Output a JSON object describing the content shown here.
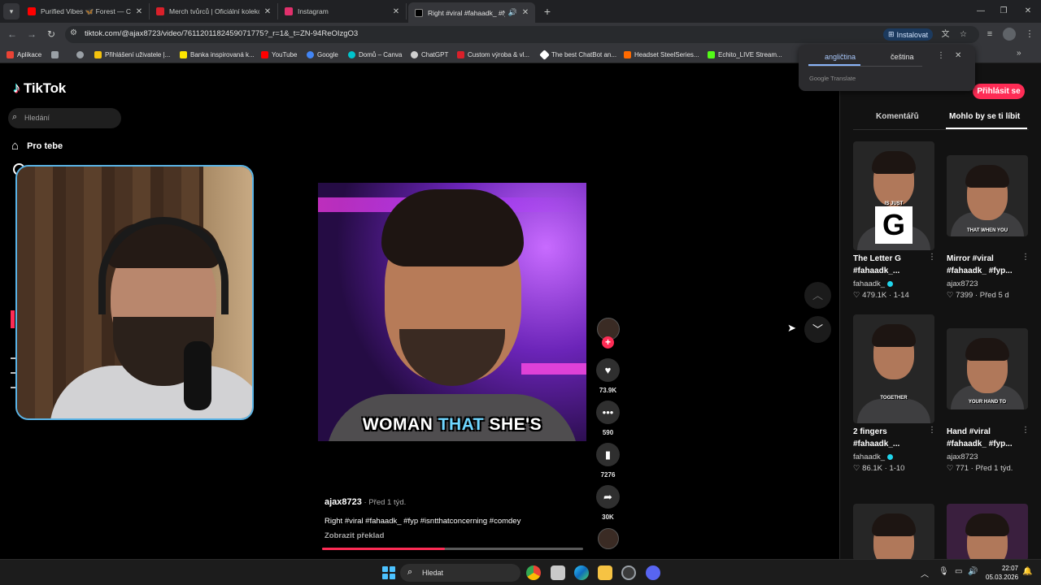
{
  "browser": {
    "tabs": [
      {
        "title": "Purified Vibes 🦋 Forest — Chi",
        "favicon_color": "#ff0000",
        "active": false
      },
      {
        "title": "Merch tvůrců | Oficiální kolekce",
        "favicon_color": "#d9202a",
        "active": false
      },
      {
        "title": "Instagram",
        "favicon_color": "#e1306c",
        "active": false
      },
      {
        "title": "Right #viral #fahaadk_ #fyp",
        "favicon_color": "#000000",
        "active": true
      }
    ],
    "url": "tiktok.com/@ajax8723/video/7611201182459071775?_r=1&_t=ZN-94ReOIzgO3",
    "install_label": "Instalovat",
    "bookmarks": [
      {
        "label": "Aplikace",
        "color": "#ea4335"
      },
      {
        "label": "",
        "color": "#9aa0a6"
      },
      {
        "label": "Přihlášení uživatele |...",
        "color": "#f4c20d"
      },
      {
        "label": "Banka inspirovaná k...",
        "color": "#fee600"
      },
      {
        "label": "YouTube",
        "color": "#ff0000"
      },
      {
        "label": "Google",
        "color": "#4285f4"
      },
      {
        "label": "Domů – Canva",
        "color": "#00c4cc"
      },
      {
        "label": "ChatGPT",
        "color": "#cfcfcf"
      },
      {
        "label": "Custom výroba & vl...",
        "color": "#d9202a"
      },
      {
        "label": "The best ChatBot an...",
        "color": "#ffffff"
      },
      {
        "label": "Headset SteelSeries...",
        "color": "#ff6a00"
      },
      {
        "label": "Echito_LIVE Stream...",
        "color": "#53fc18"
      }
    ]
  },
  "translate_popup": {
    "source_lang": "angličtina",
    "target_lang": "čeština",
    "brand": "Google Translate"
  },
  "tiktok": {
    "logo_text": "TikTok",
    "search_placeholder": "Hledání",
    "nav_for_you": "Pro tebe",
    "login_label": "Přihlásit se",
    "video": {
      "caption_before": "WOMAN ",
      "caption_highlight": "THAT",
      "caption_after": " SHE'S",
      "author": "ajax8723",
      "date": " · Před 1 týd.",
      "description": "Right #viral #fahaadk_ #fyp #isntthatconcerning #comdey",
      "translate_link": "Zobrazit překlad",
      "progress_fraction": 0.47
    },
    "actions": {
      "likes": "73.9K",
      "comments": "590",
      "saves": "7276",
      "shares": "30K"
    },
    "panel_tabs": {
      "comments": "Komentářů",
      "you_may_like": "Mohlo by se ti líbit"
    },
    "recommendations": [
      {
        "title": "The Letter G #fahaadk_...",
        "author": "fahaadk_",
        "verified": true,
        "likes": "479.1K",
        "date": "1-14",
        "overlay_top": "IS JUST",
        "overlay_bottom": "",
        "big_letter": "G"
      },
      {
        "title": "Mirror #viral #fahaadk_ #fyp...",
        "author": "ajax8723",
        "verified": false,
        "likes": "7399",
        "date": "Před 5 d",
        "overlay_top": "",
        "overlay_bottom": "THAT WHEN YOU",
        "big_letter": ""
      },
      {
        "title": "2 fingers #fahaadk_...",
        "author": "fahaadk_",
        "verified": true,
        "likes": "86.1K",
        "date": "1-10",
        "overlay_top": "",
        "overlay_bottom": "TOGETHER",
        "big_letter": ""
      },
      {
        "title": "Hand #viral #fahaadk_ #fyp...",
        "author": "ajax8723",
        "verified": false,
        "likes": "771",
        "date": "Před 1 týd.",
        "overlay_top": "",
        "overlay_bottom": "YOUR HAND TO",
        "big_letter": ""
      }
    ]
  },
  "taskbar": {
    "search_label": "Hledat",
    "time": "22:07",
    "date": "05.03.2026"
  }
}
